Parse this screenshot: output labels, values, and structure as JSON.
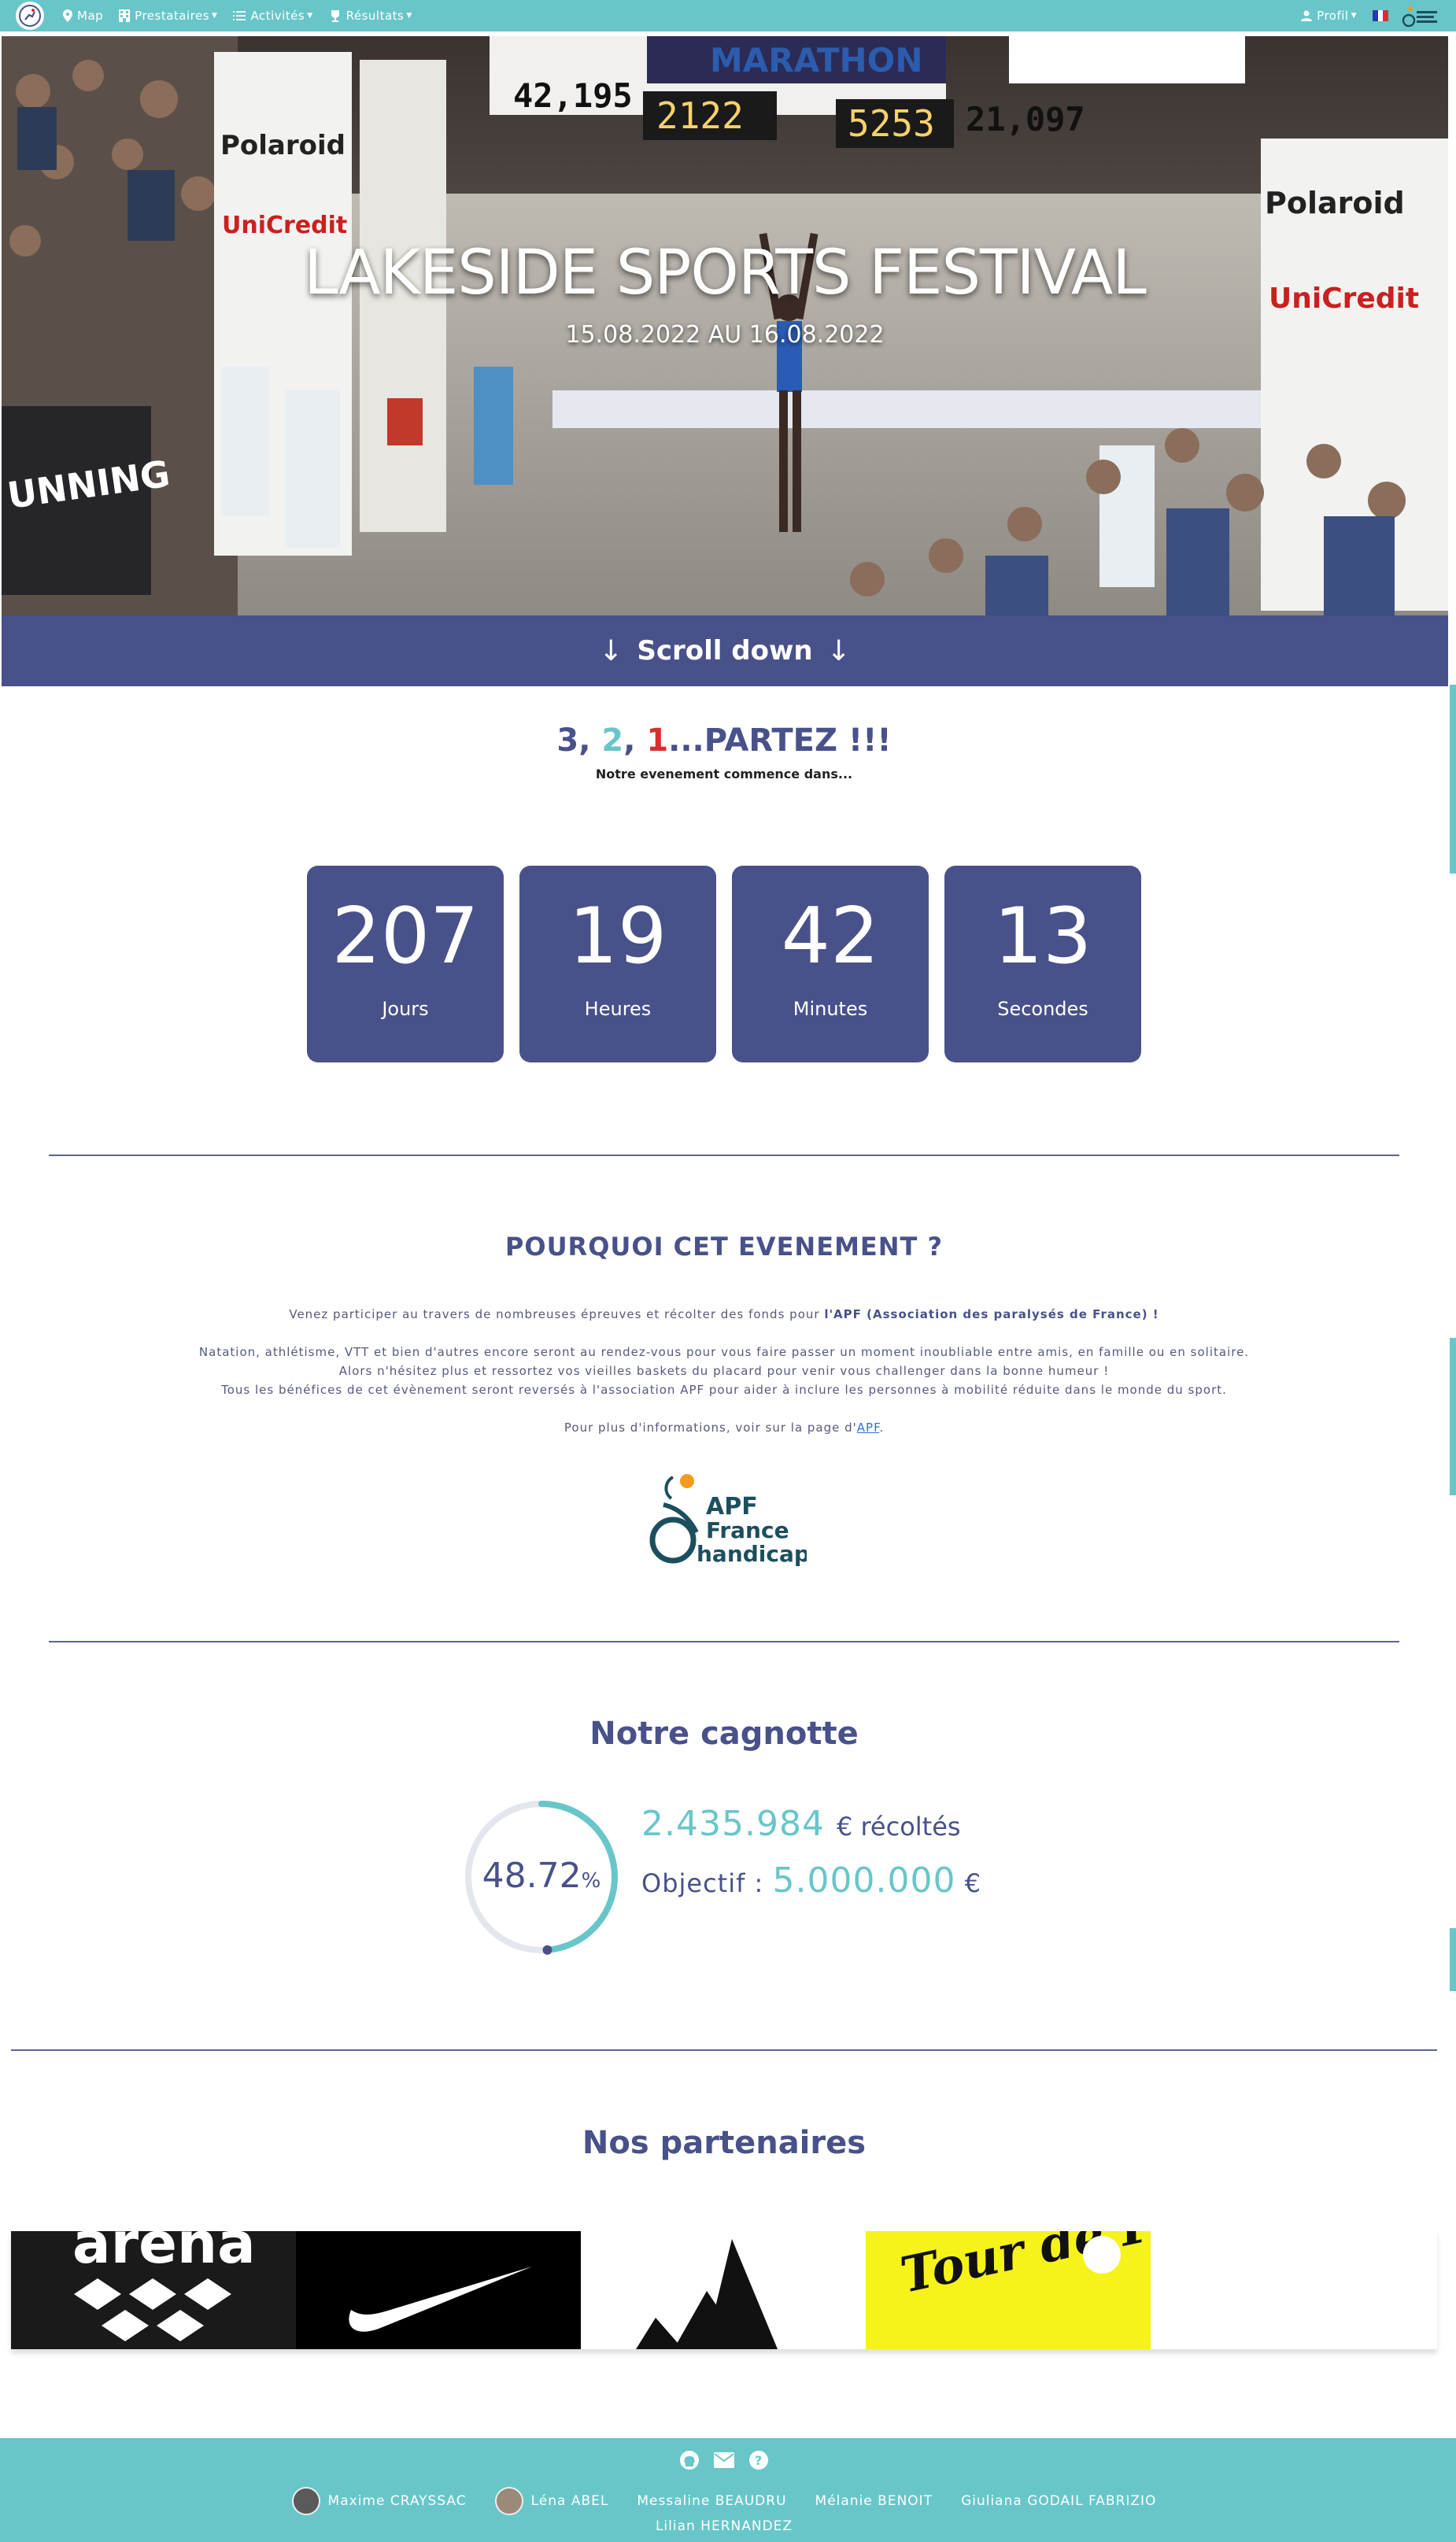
{
  "nav": {
    "items": [
      {
        "label": "Map",
        "icon": "map-pin-icon"
      },
      {
        "label": "Prestataires",
        "icon": "building-icon"
      },
      {
        "label": "Activités",
        "icon": "list-icon"
      },
      {
        "label": "Résultats",
        "icon": "trophy-icon"
      }
    ],
    "profile_label": "Profil",
    "language_flag": "france-flag-icon"
  },
  "hero": {
    "title": "LAKESIDE SPORTS FESTIVAL",
    "dates": "15.08.2022 AU 16.08.2022"
  },
  "scroll": {
    "label": "Scroll down",
    "arrow": "↓"
  },
  "countdown": {
    "title_parts": [
      "3",
      ", ",
      "2",
      ", ",
      "1",
      "...PARTEZ !!!"
    ],
    "subtitle": "Notre evenement commence dans...",
    "units": [
      {
        "value": "207",
        "label": "Jours"
      },
      {
        "value": "19",
        "label": "Heures"
      },
      {
        "value": "42",
        "label": "Minutes"
      },
      {
        "value": "13",
        "label": "Secondes"
      }
    ]
  },
  "why": {
    "title": "POURQUOI CET EVENEMENT ?",
    "line1_prefix": "Venez participer au travers de nombreuses épreuves et récolter des fonds pour ",
    "line1_bold": "l'APF (Association des paralysés de France) !",
    "line2": "Natation, athlétisme, VTT et bien d'autres encore seront au rendez-vous pour vous faire passer un moment inoubliable entre amis, en famille ou en solitaire.",
    "line3": "Alors n'hésitez plus et ressortez vos vieilles baskets du placard pour venir vous challenger dans la bonne humeur !",
    "line4": "Tous les bénéfices de cet évènement seront reversés à l'association APF pour aider à inclure les personnes à mobilité réduite dans le monde du sport.",
    "info_prefix": "Pour plus d'informations, voir sur la page d'",
    "info_link": "APF",
    "info_suffix": ".",
    "logo_lines": [
      "APF",
      "France",
      "handicap"
    ]
  },
  "cagnotte": {
    "title": "Notre cagnotte",
    "percent": "48.72",
    "percent_sign": "%",
    "percent_value": 48.72,
    "raised": "2.435.984",
    "raised_suffix": "€ récoltés",
    "goal_label": "Objectif :",
    "goal": "5.000.000",
    "currency": "€"
  },
  "partners": {
    "title": "Nos partenaires",
    "logos": [
      "arena-logo",
      "nike-logo",
      "adidas-logo",
      "tour-de-france-logo"
    ],
    "arena_text": "arena",
    "tdf_text": "Tour de France"
  },
  "footer": {
    "icons": [
      "github-icon",
      "mail-icon",
      "help-icon"
    ],
    "authors": [
      "Maxime CRAYSSAC",
      "Léna ABEL",
      "Messaline BEAUDRU",
      "Mélanie BENOIT",
      "Giuliana GODAIL FABRIZIO"
    ],
    "last_author": "Lilian HERNANDEZ"
  },
  "colors": {
    "teal": "#68c6c9",
    "navy": "#48518a",
    "red": "#d5302f",
    "yellow": "#f5f31a"
  }
}
